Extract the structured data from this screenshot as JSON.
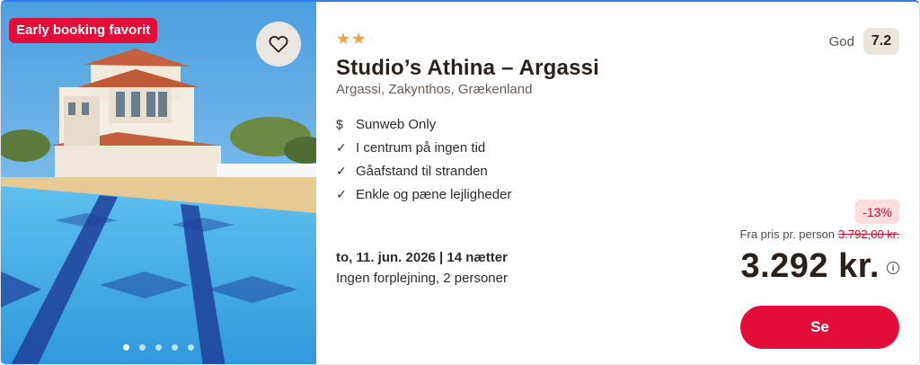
{
  "card": {
    "badge": "Early booking favorit",
    "stars": "★★",
    "title": "Studio’s Athina – Argassi",
    "location": "Argassi, Zakynthos, Grækenland",
    "features": [
      {
        "icon": "sunweb-logo-icon",
        "glyph": "$̣",
        "text": "Sunweb Only"
      },
      {
        "icon": "checkmark-icon",
        "glyph": "✓",
        "text": "I centrum på ingen tid"
      },
      {
        "icon": "checkmark-icon",
        "glyph": "✓",
        "text": "Gåafstand til stranden"
      },
      {
        "icon": "checkmark-icon",
        "glyph": "✓",
        "text": "Enkle og pæne lejligheder"
      }
    ],
    "date": "to, 11. jun. 2026 | 14 nætter",
    "board": "Ingen forplejning, 2 personer",
    "rating": {
      "label": "God",
      "score": "7.2"
    },
    "discount": "-13%",
    "from_label": "Fra pris pr. person",
    "old_price": "3.792,00 kr.",
    "price": "3.292 kr.",
    "cta": "Se",
    "carousel": {
      "count": 5,
      "active": 0
    }
  },
  "colors": {
    "accent": "#e30d3a",
    "star": "#f2a23b",
    "rating_bg": "#ece5dc"
  }
}
